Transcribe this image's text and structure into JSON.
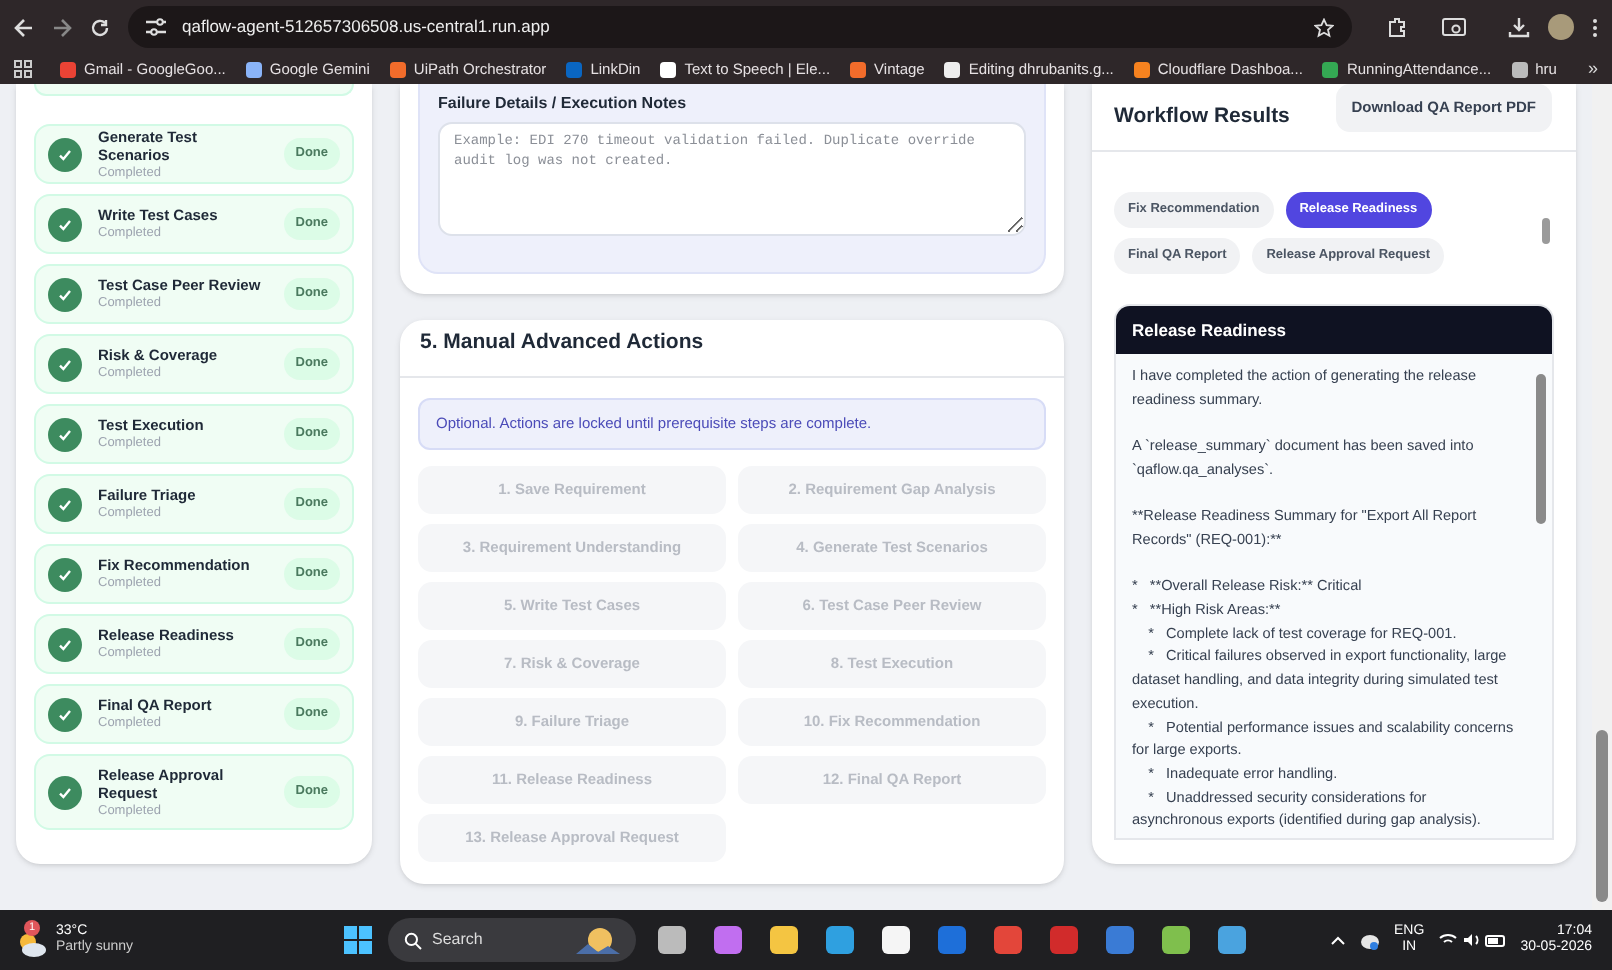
{
  "browser": {
    "url": "qaflow-agent-512657306508.us-central1.run.app",
    "bookmarks": [
      "Gmail - GoogleGoo...",
      "Google Gemini",
      "UiPath Orchestrator",
      "LinkDin",
      "Text to Speech | Ele...",
      "Vintage",
      "Editing dhrubanits.g...",
      "Cloudflare Dashboa...",
      "RunningAttendance...",
      "hru"
    ],
    "overflow": "»"
  },
  "steps": [
    {
      "title": "Generate Test Scenarios",
      "status": "Completed",
      "badge": "Done",
      "done": true
    },
    {
      "title": "Write Test Cases",
      "status": "Completed",
      "badge": "Done",
      "done": true
    },
    {
      "title": "Test Case Peer Review",
      "status": "Completed",
      "badge": "Done",
      "done": true
    },
    {
      "title": "Risk & Coverage",
      "status": "Completed",
      "badge": "Done",
      "done": true
    },
    {
      "title": "Test Execution",
      "status": "Completed",
      "badge": "Done",
      "done": true
    },
    {
      "title": "Failure Triage",
      "status": "Completed",
      "badge": "Done",
      "done": true
    },
    {
      "title": "Fix Recommendation",
      "status": "Completed",
      "badge": "Done",
      "done": true
    },
    {
      "title": "Release Readiness",
      "status": "Completed",
      "badge": "Done",
      "done": true
    },
    {
      "title": "Final QA Report",
      "status": "Completed",
      "badge": "Done",
      "done": true
    },
    {
      "title": "Release Approval Request",
      "status": "Completed",
      "badge": "Done",
      "done": true
    }
  ],
  "failure_notes": {
    "label": "Failure Details / Execution Notes",
    "placeholder": "Example: EDI 270 timeout validation failed. Duplicate override audit log was not created."
  },
  "manual_actions": {
    "title": "5. Manual Advanced Actions",
    "info": "Optional. Actions are locked until prerequisite steps are complete.",
    "actions": [
      {
        "label": "1. Save Requirement",
        "disabled": true
      },
      {
        "label": "2. Requirement Gap Analysis",
        "disabled": true
      },
      {
        "label": "3. Requirement Understanding",
        "disabled": true
      },
      {
        "label": "4. Generate Test Scenarios",
        "disabled": true
      },
      {
        "label": "5. Write Test Cases",
        "disabled": true
      },
      {
        "label": "6. Test Case Peer Review",
        "disabled": true
      },
      {
        "label": "7. Risk & Coverage",
        "disabled": true
      },
      {
        "label": "8. Test Execution",
        "disabled": true
      },
      {
        "label": "9. Failure Triage",
        "disabled": true
      },
      {
        "label": "10. Fix Recommendation",
        "disabled": true
      },
      {
        "label": "11. Release Readiness",
        "disabled": true
      },
      {
        "label": "12. Final QA Report",
        "disabled": true
      },
      {
        "label": "13. Release Approval Request",
        "disabled": true
      }
    ]
  },
  "results": {
    "title": "Workflow Results",
    "download_button": "Download QA Report PDF",
    "chips": [
      {
        "label": "Fix Recommendation",
        "selected": false
      },
      {
        "label": "Release Readiness",
        "selected": true
      },
      {
        "label": "Final QA Report",
        "selected": false
      },
      {
        "label": "Release Approval Request",
        "selected": false
      }
    ],
    "panel": {
      "title": "Release Readiness",
      "body": "I have completed the action of generating the release readiness summary.\n\nA `release_summary` document has been saved into `qaflow.qa_analyses`.\n\n**Release Readiness Summary for \"Export All Report Records\" (REQ-001):**\n\n*   **Overall Release Risk:** Critical\n*   **High Risk Areas:**\n    *   Complete lack of test coverage for REQ-001.\n    *   Critical failures observed in export functionality, large dataset handling, and data integrity during simulated test execution.\n    *   Potential performance issues and scalability concerns for large exports.\n    *   Inadequate error handling.\n    *   Unaddressed security considerations for asynchronous exports (identified during gap analysis)."
    }
  },
  "taskbar": {
    "weather": {
      "badge": "1",
      "temp": "33°C",
      "condition": "Partly sunny"
    },
    "search": "Search",
    "lang": "ENG",
    "region": "IN",
    "time": "17:04",
    "date": "30-05-2026"
  }
}
